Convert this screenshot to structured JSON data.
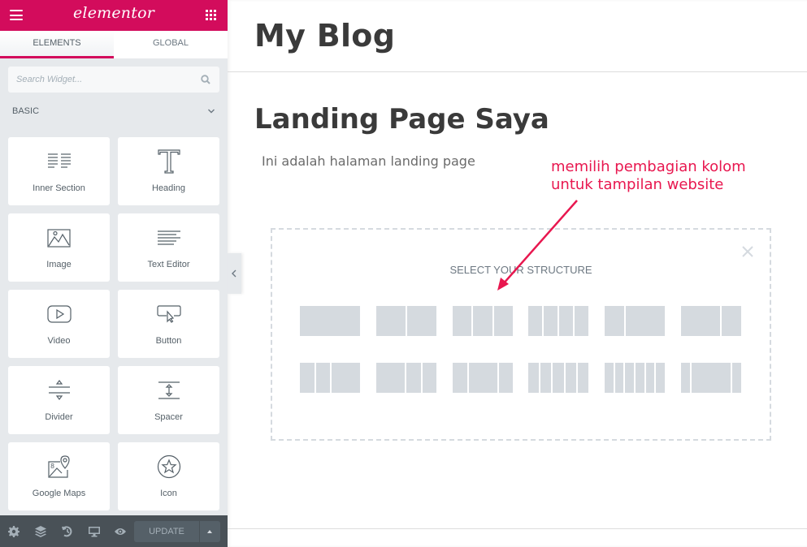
{
  "app": {
    "logo_text": "elementor",
    "brand_color": "#d30c5c"
  },
  "sidebar": {
    "tabs": [
      {
        "label": "ELEMENTS",
        "active": true
      },
      {
        "label": "GLOBAL",
        "active": false
      }
    ],
    "search": {
      "placeholder": "Search Widget...",
      "value": ""
    },
    "category": "BASIC",
    "widgets": [
      {
        "label": "Inner Section",
        "icon": "inner-section-icon"
      },
      {
        "label": "Heading",
        "icon": "heading-icon"
      },
      {
        "label": "Image",
        "icon": "image-icon"
      },
      {
        "label": "Text Editor",
        "icon": "text-editor-icon"
      },
      {
        "label": "Video",
        "icon": "video-icon"
      },
      {
        "label": "Button",
        "icon": "button-icon"
      },
      {
        "label": "Divider",
        "icon": "divider-icon"
      },
      {
        "label": "Spacer",
        "icon": "spacer-icon"
      },
      {
        "label": "Google Maps",
        "icon": "google-maps-icon"
      },
      {
        "label": "Icon",
        "icon": "star-icon"
      }
    ],
    "footer": {
      "icons": [
        "settings-icon",
        "navigator-icon",
        "history-icon",
        "responsive-icon",
        "preview-icon"
      ],
      "update_label": "UPDATE"
    }
  },
  "canvas": {
    "site_title": "My Blog",
    "page_title": "Landing Page Saya",
    "page_text": "Ini adalah halaman landing page",
    "annotation": {
      "line1": "memilih pembagian kolom",
      "line2": "untuk tampilan website",
      "color": "#e8174f"
    },
    "structure": {
      "title": "SELECT YOUR STRUCTURE",
      "presets": [
        [
          100
        ],
        [
          50,
          50
        ],
        [
          33,
          33,
          33
        ],
        [
          25,
          25,
          25,
          25
        ],
        [
          33,
          66
        ],
        [
          66,
          33
        ],
        [
          25,
          25,
          50
        ],
        [
          50,
          25,
          25
        ],
        [
          25,
          50,
          25
        ],
        [
          20,
          20,
          20,
          20,
          20
        ],
        [
          16,
          16,
          16,
          16,
          16,
          16
        ],
        [
          16,
          66,
          16
        ]
      ]
    }
  }
}
